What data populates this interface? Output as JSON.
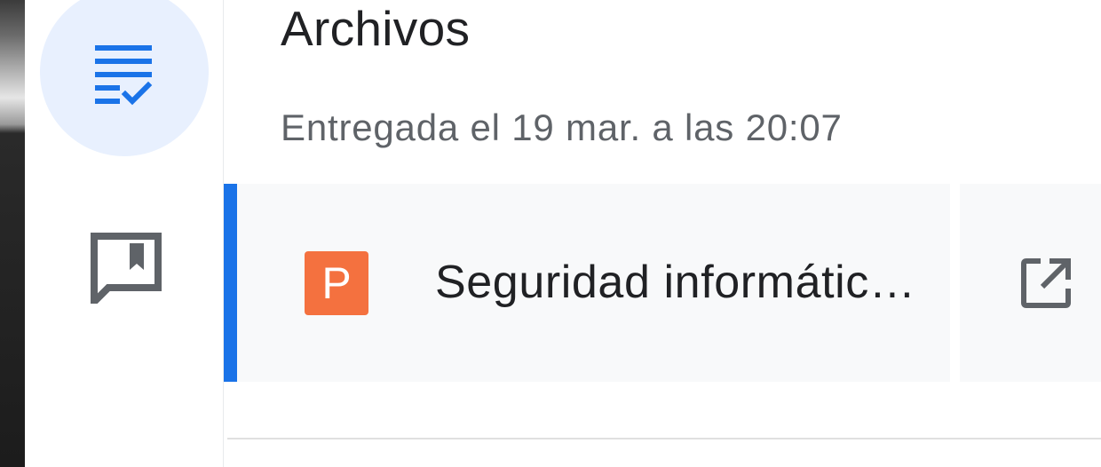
{
  "rail": {
    "items": [
      {
        "icon": "assignment-list-check-icon",
        "active": true,
        "color": "#1a73e8"
      },
      {
        "icon": "private-comment-icon",
        "active": false,
        "color": "#5f6368"
      }
    ],
    "active_bg": "#e8f0fe"
  },
  "section": {
    "title": "Archivos",
    "status": "Entregada el 19 mar. a las 20:07"
  },
  "files": [
    {
      "type_letter": "P",
      "name": "Seguridad informátic…",
      "icon": "powerpoint-file-icon",
      "icon_color": "#f4713f",
      "action_icon": "open-in-new-icon"
    }
  ],
  "colors": {
    "accent": "#1a73e8",
    "text_primary": "#202124",
    "text_secondary": "#5f6368",
    "row_bg": "#f8f9fa"
  }
}
